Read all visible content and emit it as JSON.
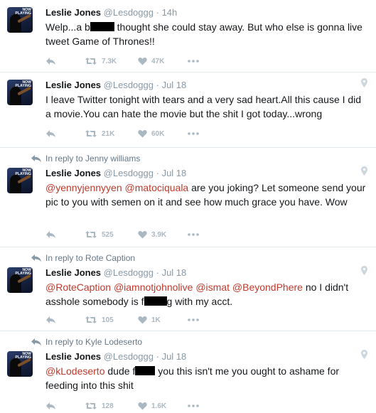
{
  "tweets": [
    {
      "reply_to": "",
      "name": "Leslie Jones",
      "handle": "@Lesdoggg",
      "separator": "·",
      "time": "14h",
      "text_parts": [
        "Welp...a b",
        " thought she could stay away. But who else is gonna live tweet Game of Thrones!!"
      ],
      "retweets": "7.3K",
      "likes": "47K",
      "has_location": false
    },
    {
      "reply_to": "",
      "name": "Leslie Jones",
      "handle": "@Lesdoggg",
      "separator": "·",
      "time": "Jul 18",
      "text": "I leave Twitter tonight with tears and a very sad heart.All this cause I did a movie.You can hate the movie but the shit I got today...wrong",
      "retweets": "21K",
      "likes": "60K",
      "has_location": true
    },
    {
      "reply_to": "In reply to Jenny williams",
      "name": "Leslie Jones",
      "handle": "@Lesdoggg",
      "separator": "·",
      "time": "Jul 18",
      "mentions": [
        "@yennyjennyyen",
        "@matociquala"
      ],
      "text": " are you joking? Let someone send your pic to you with semen on it and see how much grace you have. Wow",
      "retweets": "525",
      "likes": "3.9K",
      "has_location": true
    },
    {
      "reply_to": "In reply to Rote Caption",
      "name": "Leslie Jones",
      "handle": "@Lesdoggg",
      "separator": "·",
      "time": "Jul 18",
      "mentions": [
        "@RoteCaption",
        "@iamnotjohnolive",
        "@ismat",
        "@BeyondPhere"
      ],
      "text_parts": [
        " no I didn't asshole somebody is f",
        "g with my acct."
      ],
      "retweets": "105",
      "likes": "1K",
      "has_location": true
    },
    {
      "reply_to": "In reply to Kyle Lodeserto",
      "name": "Leslie Jones",
      "handle": "@Lesdoggg",
      "separator": "·",
      "time": "Jul 18",
      "mentions": [
        "@kLodeserto"
      ],
      "text_parts": [
        " dude f",
        " you this isn't me you ought to ashame for feeding into this shit"
      ],
      "retweets": "128",
      "likes": "1.6K",
      "has_location": true
    }
  ],
  "avatar_badge": "NOW PLAYING",
  "icons": {
    "reply": "reply-icon",
    "retweet": "retweet-icon",
    "like": "heart-icon",
    "more": "more-dots-icon",
    "location": "location-pin-icon",
    "in_reply": "in-reply-arrow-icon"
  },
  "colors": {
    "mention": "#c0392b",
    "muted": "#8899a6",
    "action": "#aab8c2",
    "divider": "#e1e8ed"
  }
}
